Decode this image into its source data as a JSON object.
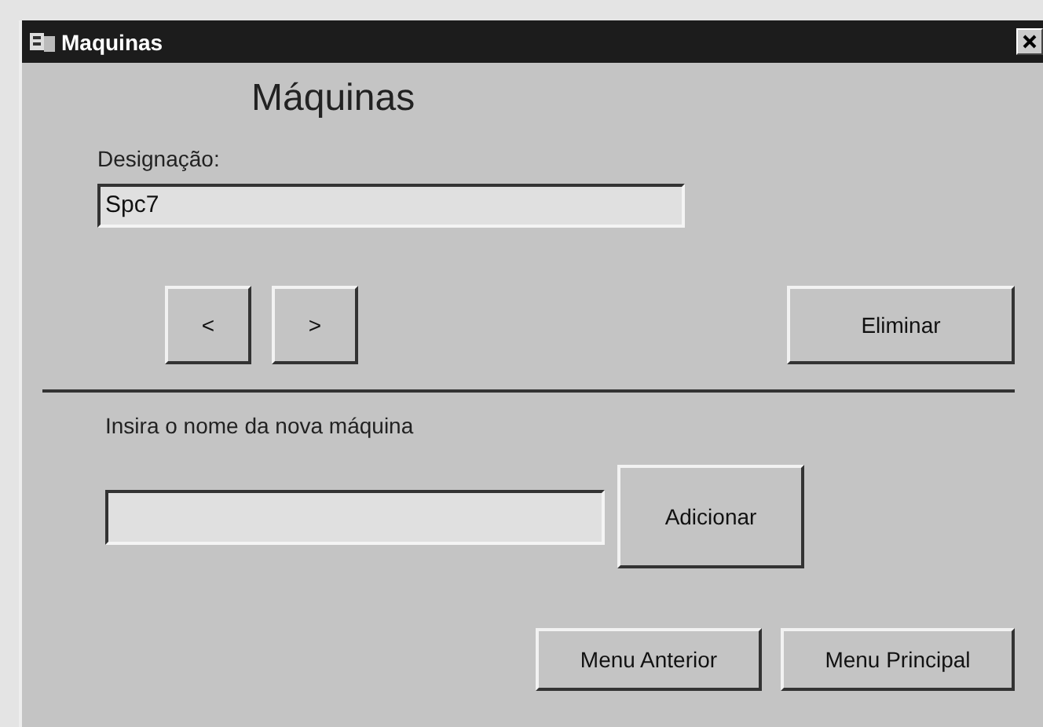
{
  "window": {
    "title": "Maquinas"
  },
  "heading": "Máquinas",
  "designation": {
    "label": "Designação:",
    "value": "Spc7"
  },
  "nav_buttons": [
    "<",
    ">"
  ],
  "delete_button": "Eliminar",
  "new_machine": {
    "label": "Insira o nome da nova máquina"
  },
  "add_button": "Adicionar",
  "footer_buttons": [
    "Menu Anterior",
    "Menu Principal"
  ]
}
